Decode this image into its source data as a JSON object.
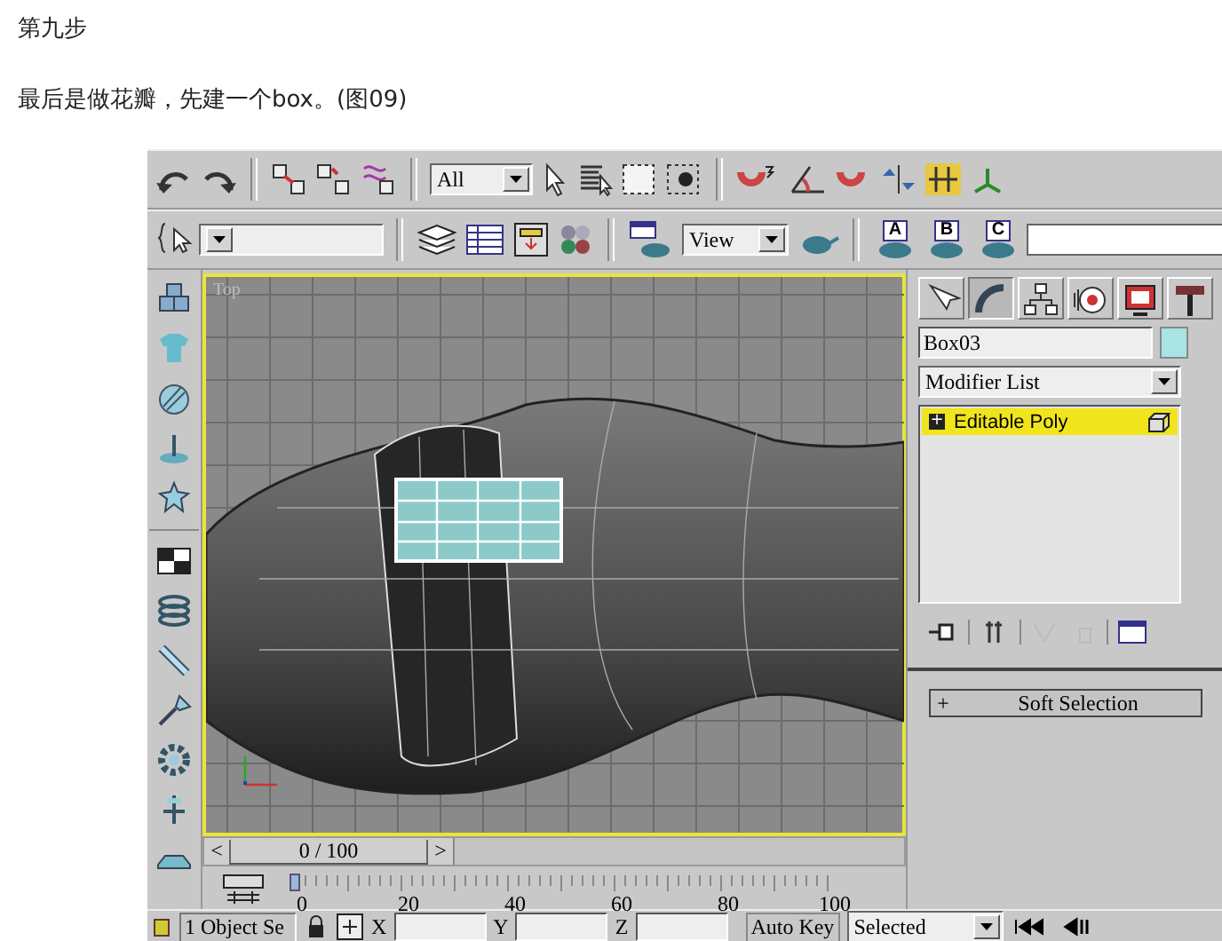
{
  "article": {
    "heading": "第九步",
    "paragraph": "最后是做花瓣，先建一个box。(图09)"
  },
  "toolbar_1": {
    "selection_filter": "All"
  },
  "toolbar_2": {
    "reference_coord": "View",
    "render_presets": [
      "A",
      "B",
      "C"
    ]
  },
  "viewport": {
    "label": "Top",
    "active": true
  },
  "time_slider": {
    "prev": "<",
    "position": "0 / 100",
    "next": ">",
    "level": 0
  },
  "track_bar": {
    "ticks": [
      "0",
      "20",
      "40",
      "60",
      "80",
      "100"
    ]
  },
  "command_panel": {
    "tabs": [
      {
        "selected": false
      },
      {
        "selected": true
      },
      {
        "selected": false
      },
      {
        "selected": false
      },
      {
        "selected": false
      },
      {
        "selected": false
      }
    ],
    "object_name": "Box03",
    "modifier_list": "Modifier List",
    "stack": [
      {
        "sign": "+",
        "label": "Editable Poly",
        "selected": true
      }
    ],
    "rollouts": [
      {
        "sign": "+",
        "label": "Soft Selection"
      }
    ]
  },
  "status_bar": {
    "selection": "1 Object Se",
    "x_label": "X",
    "y_label": "Y",
    "z_label": "Z",
    "auto_key": "Auto Key",
    "key_filter": "Selected"
  }
}
